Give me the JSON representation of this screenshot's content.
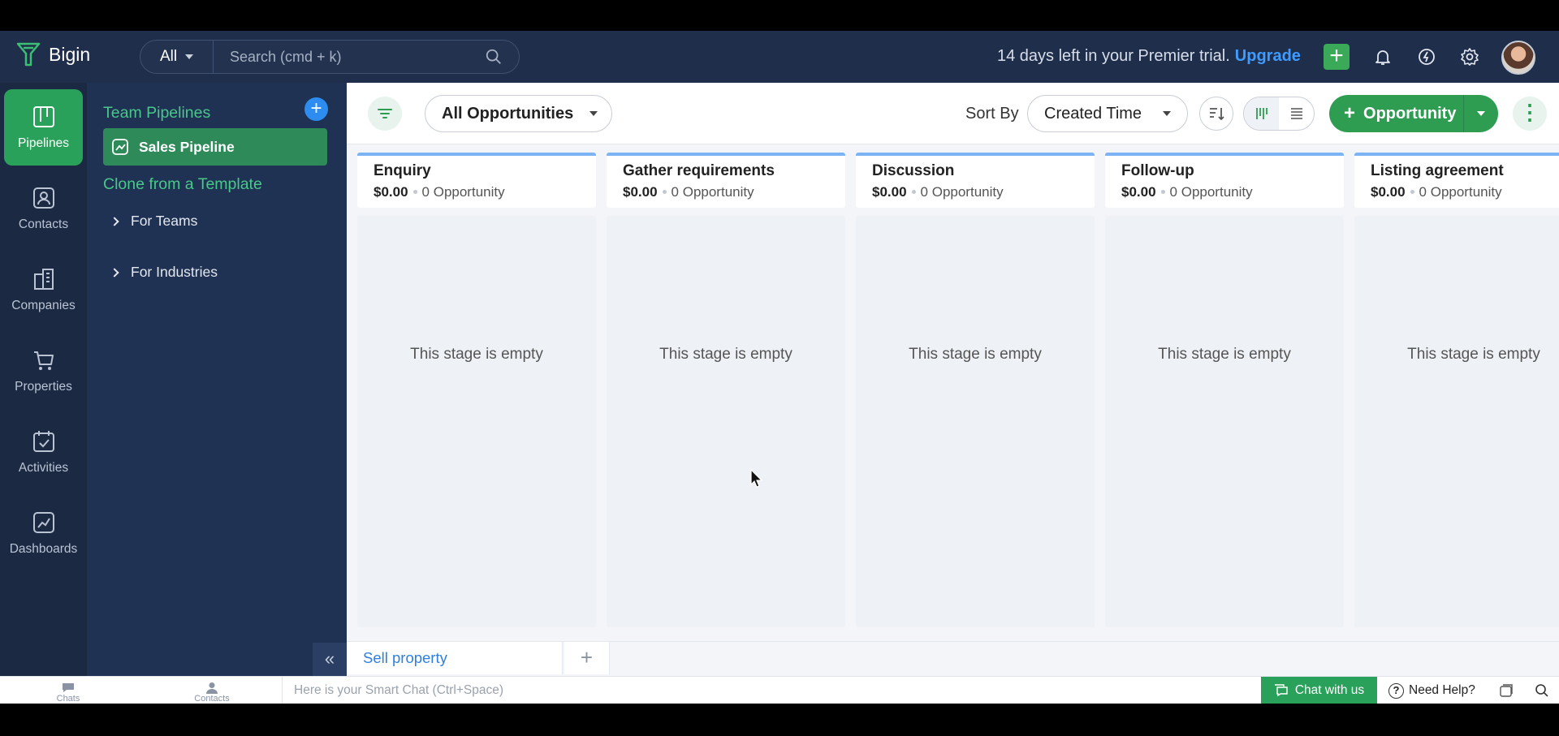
{
  "app": {
    "name": "Bigin"
  },
  "search": {
    "scope": "All",
    "placeholder": "Search (cmd + k)"
  },
  "trial": {
    "text": "14 days left in your Premier trial.",
    "upgrade": "Upgrade"
  },
  "topbar_icons": [
    "plus-icon",
    "bell-icon",
    "signal-icon",
    "gear-icon"
  ],
  "rail": {
    "items": [
      {
        "label": "Pipelines",
        "icon": "pipeline-icon",
        "active": true
      },
      {
        "label": "Contacts",
        "icon": "contact-icon"
      },
      {
        "label": "Companies",
        "icon": "building-icon"
      },
      {
        "label": "Properties",
        "icon": "cart-icon"
      },
      {
        "label": "Activities",
        "icon": "calendar-check-icon"
      },
      {
        "label": "Dashboards",
        "icon": "chart-icon"
      }
    ]
  },
  "panel": {
    "team_heading": "Team Pipelines",
    "active_pipeline": "Sales Pipeline",
    "clone_heading": "Clone from a Template",
    "tree": [
      {
        "label": "For Teams"
      },
      {
        "label": "For Industries"
      }
    ]
  },
  "toolbar": {
    "view": "All Opportunities",
    "sort_label": "Sort By",
    "sort_value": "Created Time",
    "new_button": "Opportunity"
  },
  "stages": [
    {
      "name": "Enquiry",
      "amount": "$0.00",
      "count": "0 Opportunity",
      "empty": "This stage is empty"
    },
    {
      "name": "Gather requirements",
      "amount": "$0.00",
      "count": "0 Opportunity",
      "empty": "This stage is empty"
    },
    {
      "name": "Discussion",
      "amount": "$0.00",
      "count": "0 Opportunity",
      "empty": "This stage is empty"
    },
    {
      "name": "Follow-up",
      "amount": "$0.00",
      "count": "0 Opportunity",
      "empty": "This stage is empty"
    },
    {
      "name": "Listing agreement",
      "amount": "$0.00",
      "count": "0 Opportunity",
      "empty": "This stage is empty"
    }
  ],
  "tabs": {
    "active": "Sell property"
  },
  "statusbar": {
    "chats": "Chats",
    "contacts": "Contacts",
    "smart_chat": "Here is your Smart Chat (Ctrl+Space)",
    "chat_with_us": "Chat with us",
    "need_help": "Need Help?"
  },
  "colors": {
    "topbar": "#1f2e4a",
    "rail": "#1b2943",
    "accent_green": "#2e9d52",
    "link_blue": "#3e9bff"
  }
}
